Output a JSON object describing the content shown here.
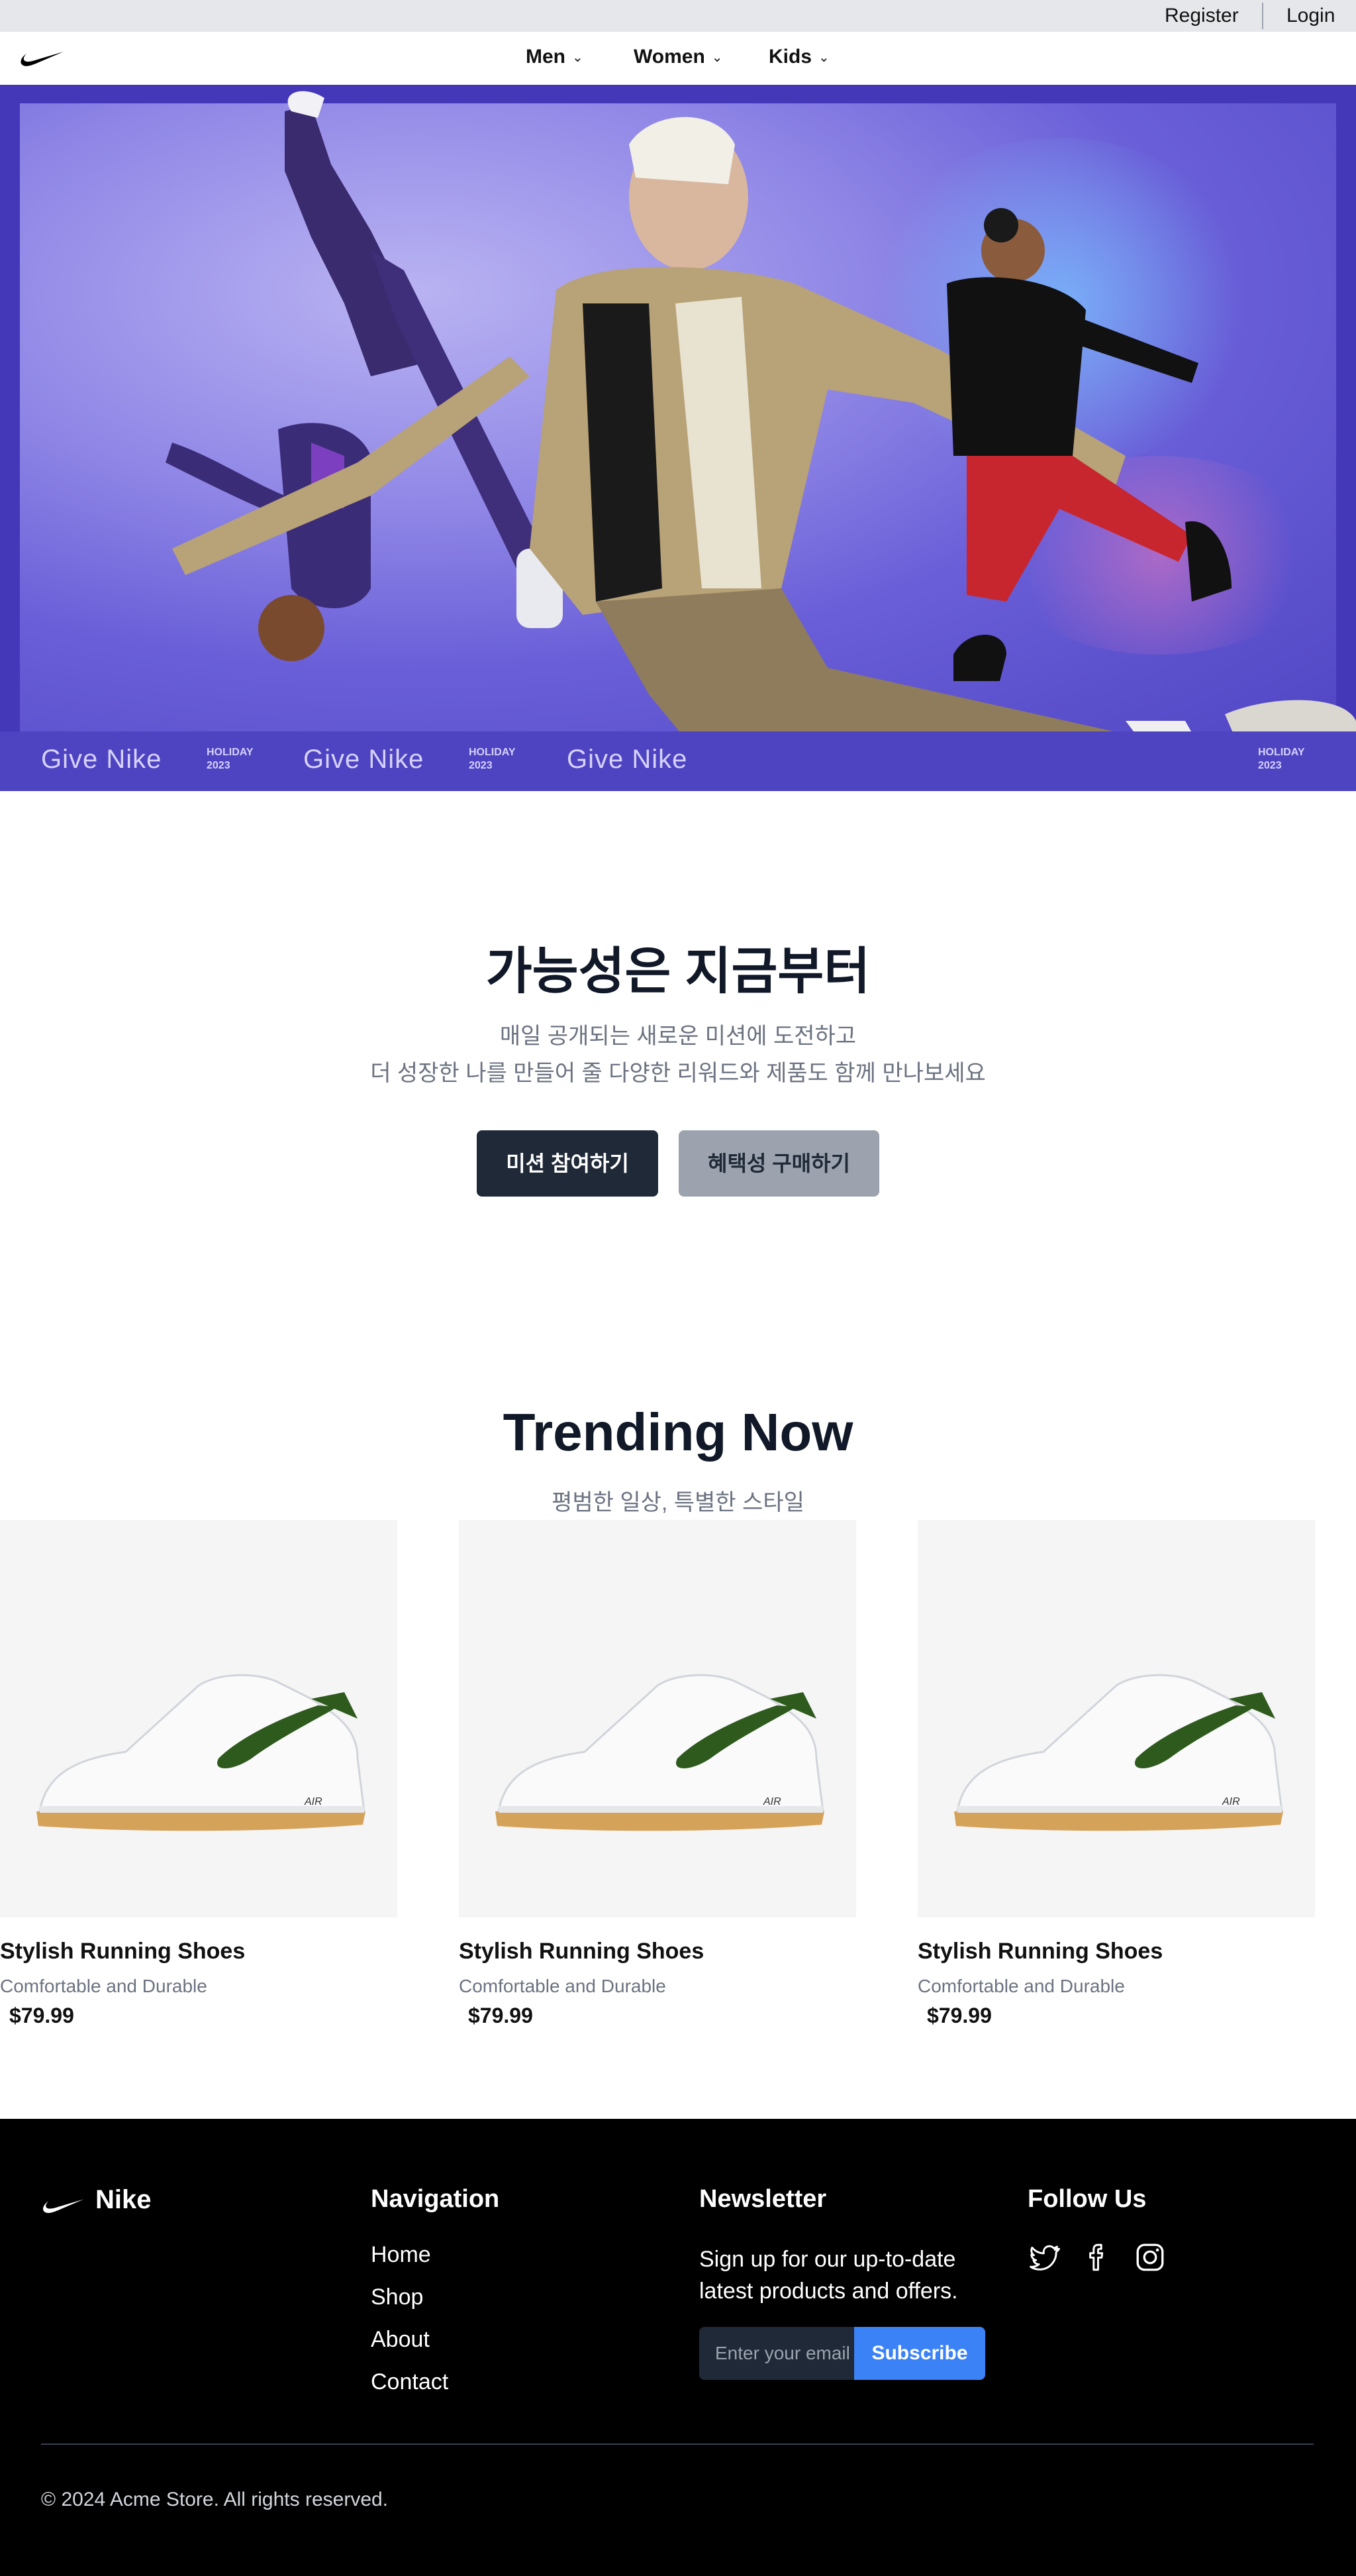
{
  "utility_bar": {
    "register": "Register",
    "login": "Login"
  },
  "nav": {
    "items": [
      {
        "label": "Men"
      },
      {
        "label": "Women"
      },
      {
        "label": "Kids"
      }
    ]
  },
  "hero": {
    "banner_repeat": [
      {
        "brand": "Give Nike",
        "holiday": "HOLIDAY",
        "year": "2023"
      }
    ]
  },
  "intro": {
    "title": "가능성은 지금부터",
    "line1": "매일 공개되는 새로운 미션에 도전하고",
    "line2": "더 성장한 나를 만들어 줄 다양한 리워드와 제품도 함께 만나보세요",
    "primary_button": "미션 참여하기",
    "secondary_button": "혜택성 구매하기"
  },
  "trending": {
    "title": "Trending Now",
    "subtitle": "평범한 일상, 특별한 스타일",
    "products": [
      {
        "name": "Stylish Running Shoes",
        "description": "Comfortable and Durable",
        "price": "$79.99"
      },
      {
        "name": "Stylish Running Shoes",
        "description": "Comfortable and Durable",
        "price": "$79.99"
      },
      {
        "name": "Stylish Running Shoes",
        "description": "Comfortable and Durable",
        "price": "$79.99"
      }
    ]
  },
  "footer": {
    "brand": "Nike",
    "navigation_title": "Navigation",
    "links": [
      "Home",
      "Shop",
      "About",
      "Contact"
    ],
    "newsletter_title": "Newsletter",
    "newsletter_text": "Sign up for our up-to-date latest products and offers.",
    "email_placeholder": "Enter your email",
    "subscribe": "Subscribe",
    "follow_title": "Follow Us",
    "copyright": "© 2024 Acme Store. All rights reserved."
  },
  "colors": {
    "primary_button": "#1f2937",
    "secondary_button": "#9ca3af",
    "subscribe": "#3b82f6",
    "hero_bg": "#4438b8",
    "footer_bg": "#000000"
  }
}
